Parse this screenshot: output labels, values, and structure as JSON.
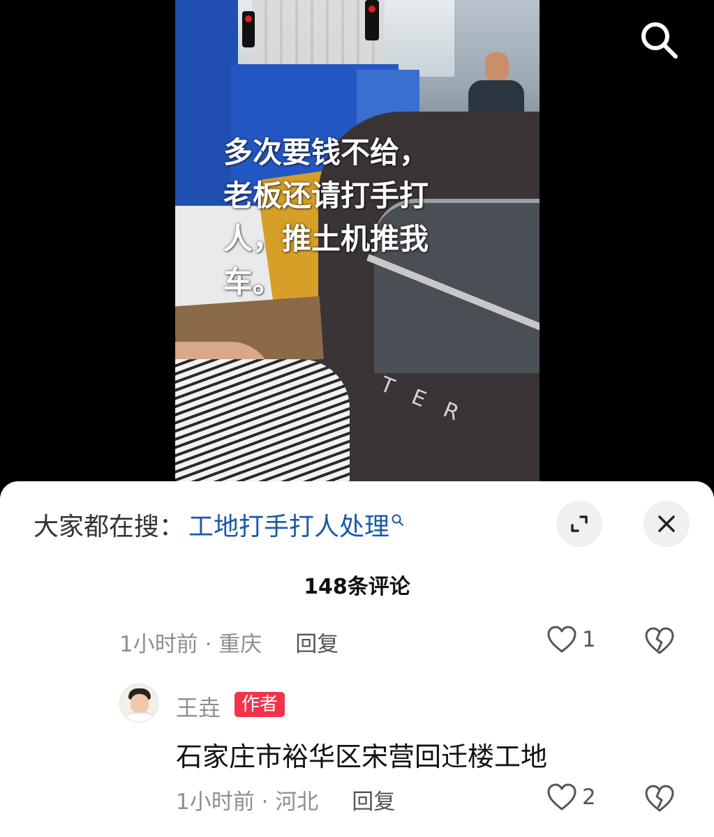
{
  "video": {
    "caption": "多次要钱不给，\n老板还请打手打\n人，推土机推我\n车。",
    "car_badge": "TER"
  },
  "top_bar": {
    "search_icon": "search-icon"
  },
  "sheet": {
    "suggest_label": "大家都在搜：",
    "suggest_query": "工地打手打人处理",
    "comment_count": "148条评论",
    "comments": [
      {
        "meta": "1小时前 · 重庆",
        "reply": "回复",
        "likes": "1"
      },
      {
        "author": "王垚",
        "author_tag": "作者",
        "text": "石家庄市裕华区宋营回迁楼工地",
        "meta": "1小时前 · 河北",
        "reply": "回复",
        "likes": "2"
      }
    ]
  },
  "colors": {
    "link": "#1a5aa8",
    "author_tag": "#f2344a",
    "meta_gray": "#8e8e8e"
  }
}
